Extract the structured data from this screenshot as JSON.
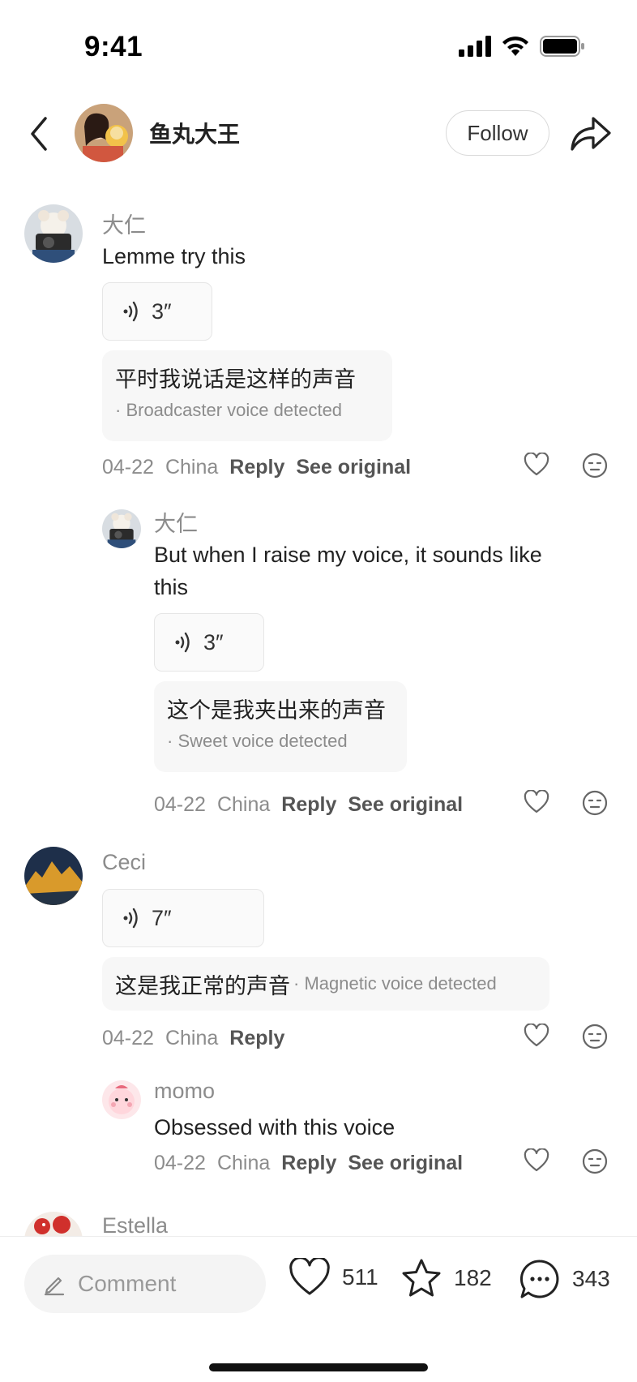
{
  "status_bar": {
    "time": "9:41"
  },
  "header": {
    "author_name": "鱼丸大王",
    "follow_label": "Follow"
  },
  "comments": [
    {
      "user": "大仁",
      "text": "Lemme try this",
      "voice_duration": "3″",
      "transcript": "平时我说话是这样的声音",
      "detected": "· Broadcaster voice detected",
      "date": "04-22",
      "location": "China",
      "reply": "Reply",
      "see_original": "See original"
    },
    {
      "user": "大仁",
      "text_line1": "But when I raise my voice, it sounds like",
      "text_line2": "this",
      "voice_duration": "3″",
      "transcript": "这个是我夹出来的声音",
      "detected": "· Sweet voice detected",
      "date": "04-22",
      "location": "China",
      "reply": "Reply",
      "see_original": "See original"
    },
    {
      "user": "Ceci",
      "voice_duration": "7″",
      "transcript": "这是我正常的声音",
      "detected": "· Magnetic voice detected",
      "date": "04-22",
      "location": "China",
      "reply": "Reply"
    },
    {
      "user": "momo",
      "text": "Obsessed with this voice",
      "date": "04-22",
      "location": "China",
      "reply": "Reply",
      "see_original": "See original"
    },
    {
      "user": "Estella"
    }
  ],
  "bottom_bar": {
    "comment_placeholder": "Comment",
    "likes": "511",
    "stars": "182",
    "comments": "343"
  }
}
